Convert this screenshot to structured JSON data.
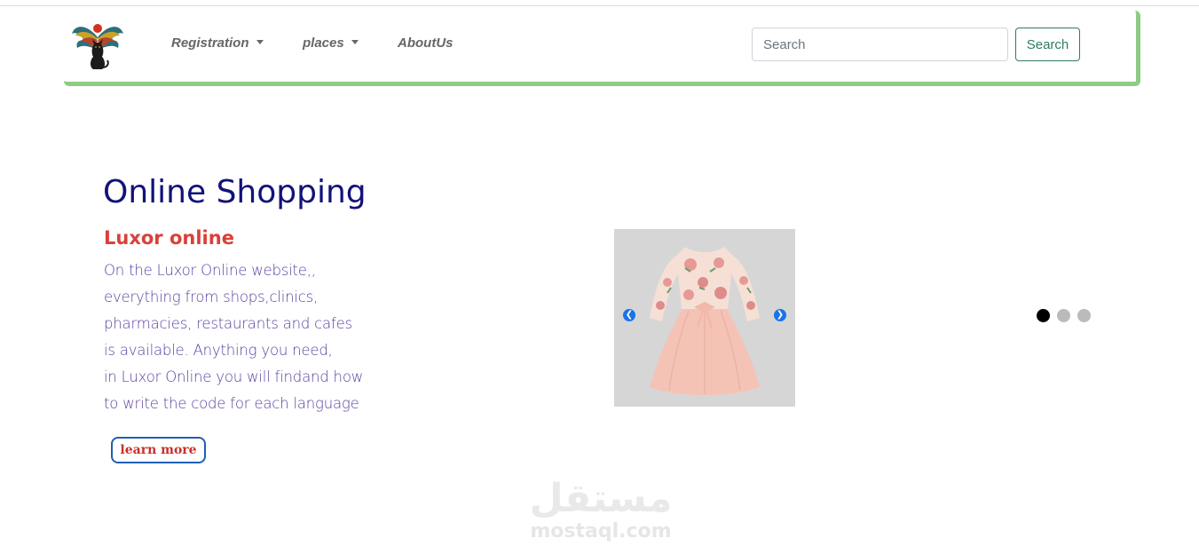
{
  "navbar": {
    "logo_icon": "winged-cat-logo-icon",
    "items": [
      {
        "label": "Registration",
        "has_dropdown": true
      },
      {
        "label": "places",
        "has_dropdown": true
      },
      {
        "label": "AboutUs",
        "has_dropdown": false
      }
    ],
    "search": {
      "placeholder": "Search",
      "value": ""
    },
    "search_button_label": "Search",
    "accent_color": "#8ecb85"
  },
  "hero": {
    "title": "Online Shopping",
    "subtitle": "Luxor online",
    "description_lines": [
      "On the Luxor Online website,,",
      "everything from shops,clinics,",
      "pharmacies, restaurants and cafes",
      "is available. Anything you need,",
      "in Luxor Online you will findand how",
      "to write the code for each language"
    ],
    "cta_label": "learn more",
    "title_color": "#12127a",
    "subtitle_color": "#d9413a"
  },
  "carousel": {
    "image_icon": "pink-floral-dress-image",
    "prev_icon": "chevron-left-icon",
    "next_icon": "chevron-right-icon",
    "slide_count": 3,
    "active_index": 0
  },
  "watermark": {
    "arabic": "مستقل",
    "latin": "mostaql.com"
  }
}
